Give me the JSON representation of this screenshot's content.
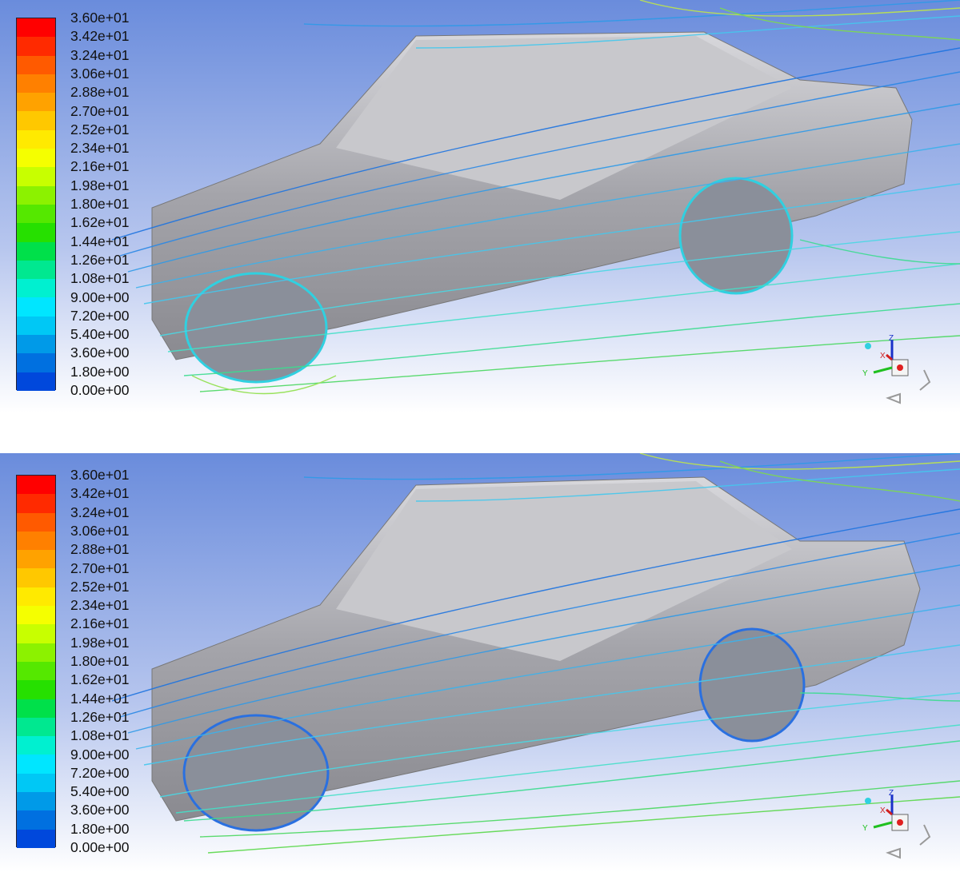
{
  "legend": {
    "labels": [
      "3.60e+01",
      "3.42e+01",
      "3.24e+01",
      "3.06e+01",
      "2.88e+01",
      "2.70e+01",
      "2.52e+01",
      "2.34e+01",
      "2.16e+01",
      "1.98e+01",
      "1.80e+01",
      "1.62e+01",
      "1.44e+01",
      "1.26e+01",
      "1.08e+01",
      "9.00e+00",
      "7.20e+00",
      "5.40e+00",
      "3.60e+00",
      "1.80e+00",
      "0.00e+00"
    ],
    "colors": [
      "#ff0000",
      "#ff2a00",
      "#ff5a00",
      "#ff8000",
      "#ffa200",
      "#ffc800",
      "#ffea00",
      "#f5ff00",
      "#c8ff00",
      "#8cf200",
      "#55e800",
      "#26e000",
      "#00e04a",
      "#00e890",
      "#00f0d0",
      "#00e6ff",
      "#00c8f5",
      "#009ae8",
      "#0070e0",
      "#0048dc",
      "#0020d8"
    ]
  },
  "panels": [
    {
      "id": "top",
      "title": ""
    },
    {
      "id": "bottom",
      "title": ""
    }
  ],
  "triad": {
    "z": "Z",
    "x": "X",
    "y": "Y"
  },
  "colors": {
    "background_top": "#6e8fdc",
    "background_bottom": "#ffffff",
    "car_body": "#a8a8ac",
    "streamline_low": "#1e6fe0",
    "streamline_mid": "#36d6e6",
    "streamline_high": "#3ad64a"
  }
}
